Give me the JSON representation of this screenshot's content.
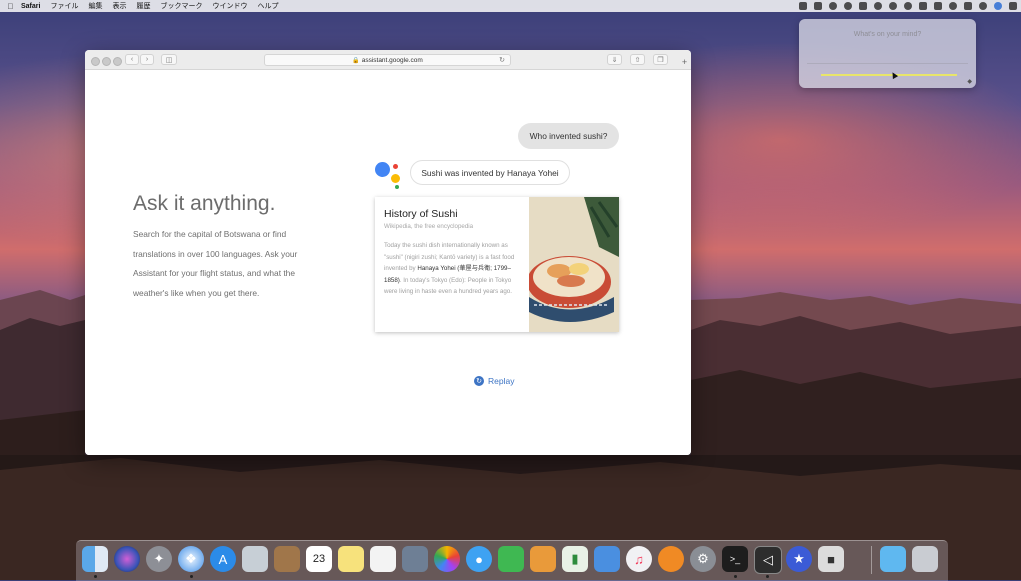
{
  "menubar": {
    "items": [
      "Safari",
      "ファイル",
      "編集",
      "表示",
      "履歴",
      "ブックマーク",
      "ウインドウ",
      "ヘルプ"
    ]
  },
  "siri_popup": {
    "prompt": "What's on your mind?"
  },
  "browser": {
    "url": "assistant.google.com"
  },
  "page": {
    "headline": "Ask it anything.",
    "body": "Search for the capital of Botswana or find translations in over 100 languages. Ask your Assistant for your flight status, and what the weather's like when you get there.",
    "user_query": "Who invented sushi?",
    "assistant_reply": "Sushi was invented by Hanaya Yohei",
    "card": {
      "title": "History of Sushi",
      "source": "Wikipedia, the free encyclopedia",
      "text_before": "Today the sushi dish internationally known as \"sushi\" (nigiri zushi; Kantō variety) is a fast food invented by",
      "text_highlight": "Hanaya Yohei (華屋与兵衛; 1799–1858)",
      "text_after": ". In today's Tokyo (Edo): People in Tokyo were living in haste even a hundred years ago."
    },
    "replay_label": "Replay"
  },
  "dock": {
    "calendar_day": "23",
    "icons": [
      "finder-icon",
      "siri-icon",
      "launchpad-icon",
      "safari-icon",
      "app-store-icon",
      "preview-icon",
      "contacts-icon",
      "calendar-icon",
      "notes-icon",
      "reminders-icon",
      "photo-booth-icon",
      "photos-icon",
      "messages-icon",
      "facetime-icon",
      "pages-icon",
      "numbers-icon",
      "keynote-icon",
      "music-icon",
      "books-icon",
      "system-preferences-icon",
      "terminal-icon",
      "xcode-icon",
      "imovie-icon",
      "robot-app-icon",
      "downloads-folder-icon",
      "trash-icon"
    ]
  },
  "colors": {
    "google_blue": "#4285F4",
    "google_red": "#EA4335",
    "google_yellow": "#FBBC05",
    "google_green": "#34A853",
    "link_blue": "#3d74c4"
  }
}
